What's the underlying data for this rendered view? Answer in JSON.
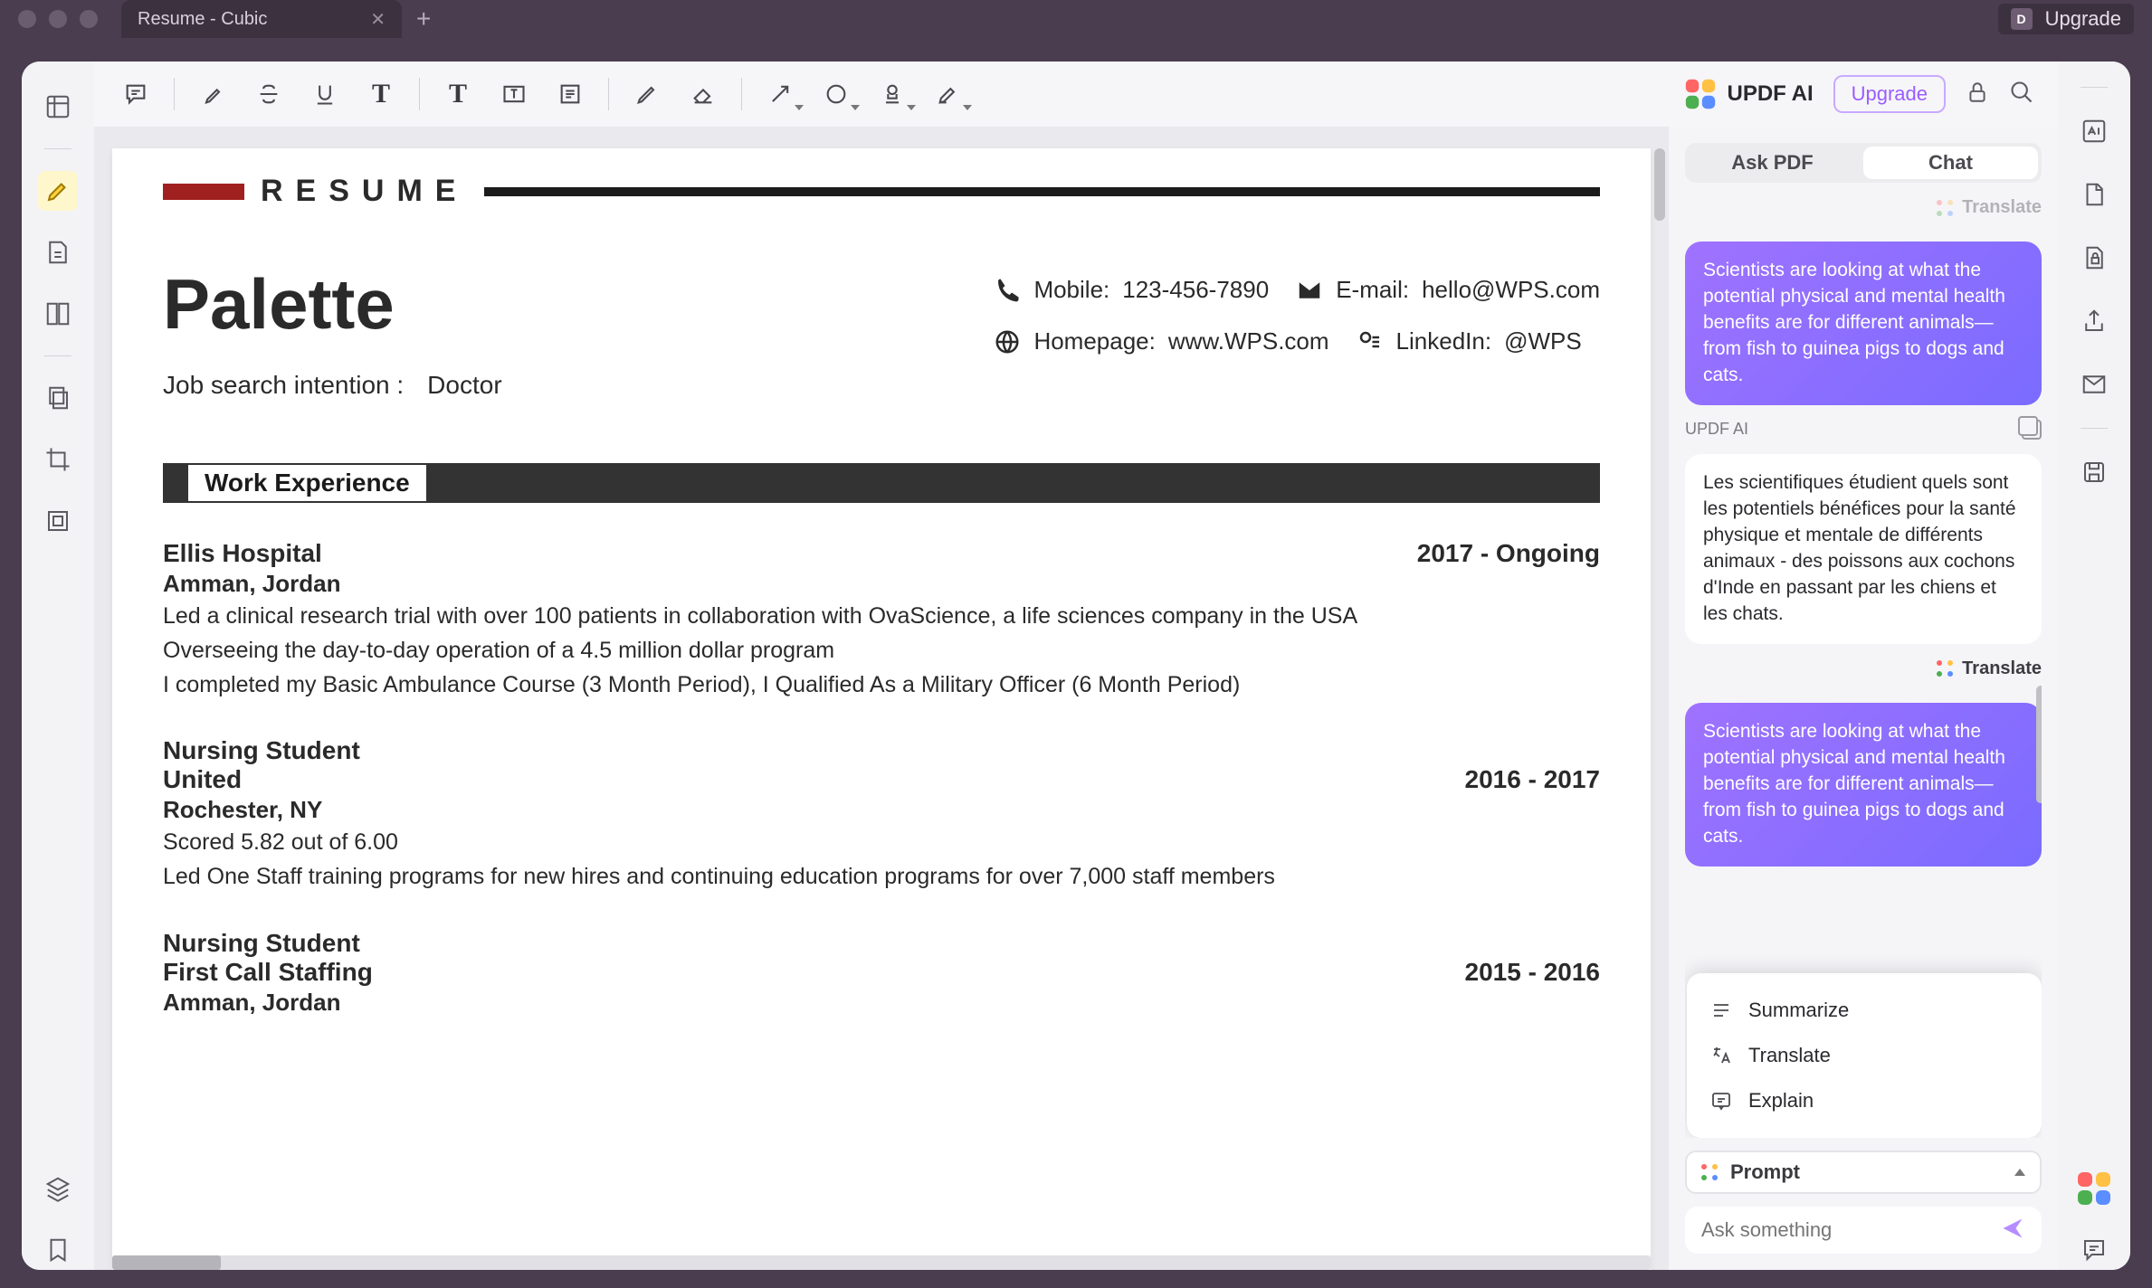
{
  "titlebar": {
    "tab_title": "Resume - Cubic",
    "avatar_letter": "D",
    "upgrade": "Upgrade"
  },
  "toolbar": {
    "ai_label": "UPDF AI",
    "upgrade_pill": "Upgrade"
  },
  "doc": {
    "resume_heading": "RESUME",
    "name": "Palette",
    "mobile_label": "Mobile:",
    "mobile_value": "123-456-7890",
    "email_label": "E-mail:",
    "email_value": "hello@WPS.com",
    "intent_label": "Job search intention :",
    "intent_value": "Doctor",
    "homepage_label": "Homepage:",
    "homepage_value": "www.WPS.com",
    "linkedin_label": "LinkedIn:",
    "linkedin_value": "@WPS",
    "section_work": "Work Experience",
    "jobs": [
      {
        "title": "Ellis Hospital",
        "dates": "2017 - Ongoing",
        "loc": "Amman,  Jordan",
        "l1": "Led a  clinical research trial with over 100 patients in collaboration with OvaScience, a life sciences company in the USA",
        "l2": "Overseeing the day-to-day operation of a 4.5 million dollar program",
        "l3": "I completed my Basic Ambulance Course (3 Month Period), I Qualified As a Military Officer (6 Month Period)"
      },
      {
        "title": "Nursing Student",
        "dates": "2016 - 2017",
        "loc": "United",
        "loc2": "Rochester, NY",
        "l1": "Scored 5.82 out of 6.00",
        "l2": "Led  One  Staff  training  programs  for  new hires and continuing education programs for over 7,000 staff members"
      },
      {
        "title": "Nursing Student",
        "dates": "2015 - 2016",
        "loc": "First Call Staffing",
        "loc2": "Amman,  Jordan"
      }
    ]
  },
  "ai": {
    "tab_ask": "Ask PDF",
    "tab_chat": "Chat",
    "chip_translate": "Translate",
    "user_msg": "Scientists are looking at what the potential physical and mental health benefits are for different animals—from fish to guinea pigs to dogs and cats.",
    "label_ai": "UPDF AI",
    "ai_msg": "Les scientifiques étudient quels sont les potentiels bénéfices pour la santé physique et mentale de différents animaux - des poissons aux cochons d'Inde en passant par les chiens et les chats.",
    "actions": {
      "summarize": "Summarize",
      "translate": "Translate",
      "explain": "Explain"
    },
    "prompt_label": "Prompt",
    "ask_placeholder": "Ask something"
  }
}
